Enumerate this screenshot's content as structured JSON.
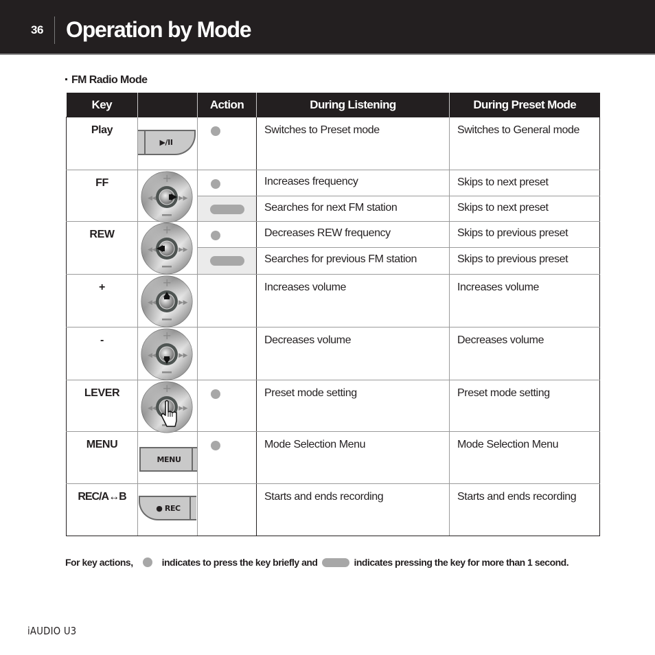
{
  "header": {
    "page_number": "36",
    "title": "Operation by Mode"
  },
  "section": {
    "title": "FM Radio Mode"
  },
  "table": {
    "columns": [
      "Key",
      "",
      "Action",
      "During Listening",
      "During Preset Mode"
    ],
    "rows": [
      {
        "key": "Play",
        "button_image": "play-pause-button",
        "button_label": "▶/II",
        "actions": [
          {
            "press": "short",
            "listening": "Switches to Preset mode",
            "preset": "Switches to General mode"
          }
        ]
      },
      {
        "key": "FF",
        "button_image": "dial-ff",
        "actions": [
          {
            "press": "short",
            "listening": "Increases frequency",
            "preset": "Skips to next preset"
          },
          {
            "press": "long",
            "listening": "Searches for next FM station",
            "preset": "Skips to next preset"
          }
        ]
      },
      {
        "key": "REW",
        "button_image": "dial-rew",
        "actions": [
          {
            "press": "short",
            "listening": "Decreases REW frequency",
            "preset": "Skips to previous preset"
          },
          {
            "press": "long",
            "listening": "Searches for previous FM station",
            "preset": "Skips to previous preset"
          }
        ]
      },
      {
        "key": "+",
        "button_image": "dial-plus",
        "actions": [
          {
            "press": "none",
            "listening": "Increases volume",
            "preset": "Increases volume"
          }
        ]
      },
      {
        "key": "-",
        "button_image": "dial-minus",
        "actions": [
          {
            "press": "none",
            "listening": "Decreases volume",
            "preset": "Decreases volume"
          }
        ]
      },
      {
        "key": "LEVER",
        "button_image": "dial-lever-press",
        "actions": [
          {
            "press": "short",
            "listening": "Preset mode setting",
            "preset": "Preset mode setting"
          }
        ]
      },
      {
        "key": "MENU",
        "button_image": "menu-button",
        "button_label": "MENU",
        "actions": [
          {
            "press": "short",
            "listening": "Mode Selection Menu",
            "preset": "Mode Selection Menu"
          }
        ]
      },
      {
        "key": "REC/A↔B",
        "button_image": "rec-button",
        "button_label": "● REC",
        "actions": [
          {
            "press": "none",
            "listening": "Starts and ends recording",
            "preset": "Starts and ends recording"
          }
        ]
      }
    ]
  },
  "footer": {
    "note_part1": "For key actions,",
    "note_part2": "indicates to press the key briefly and",
    "note_part3": "indicates pressing the key for more than 1 second.",
    "model": "iAUDIO U3"
  },
  "colors": {
    "header_bg": "#231f20",
    "press_indicator": "#a7a7a7",
    "long_press_cell_bg": "#ebebeb"
  }
}
